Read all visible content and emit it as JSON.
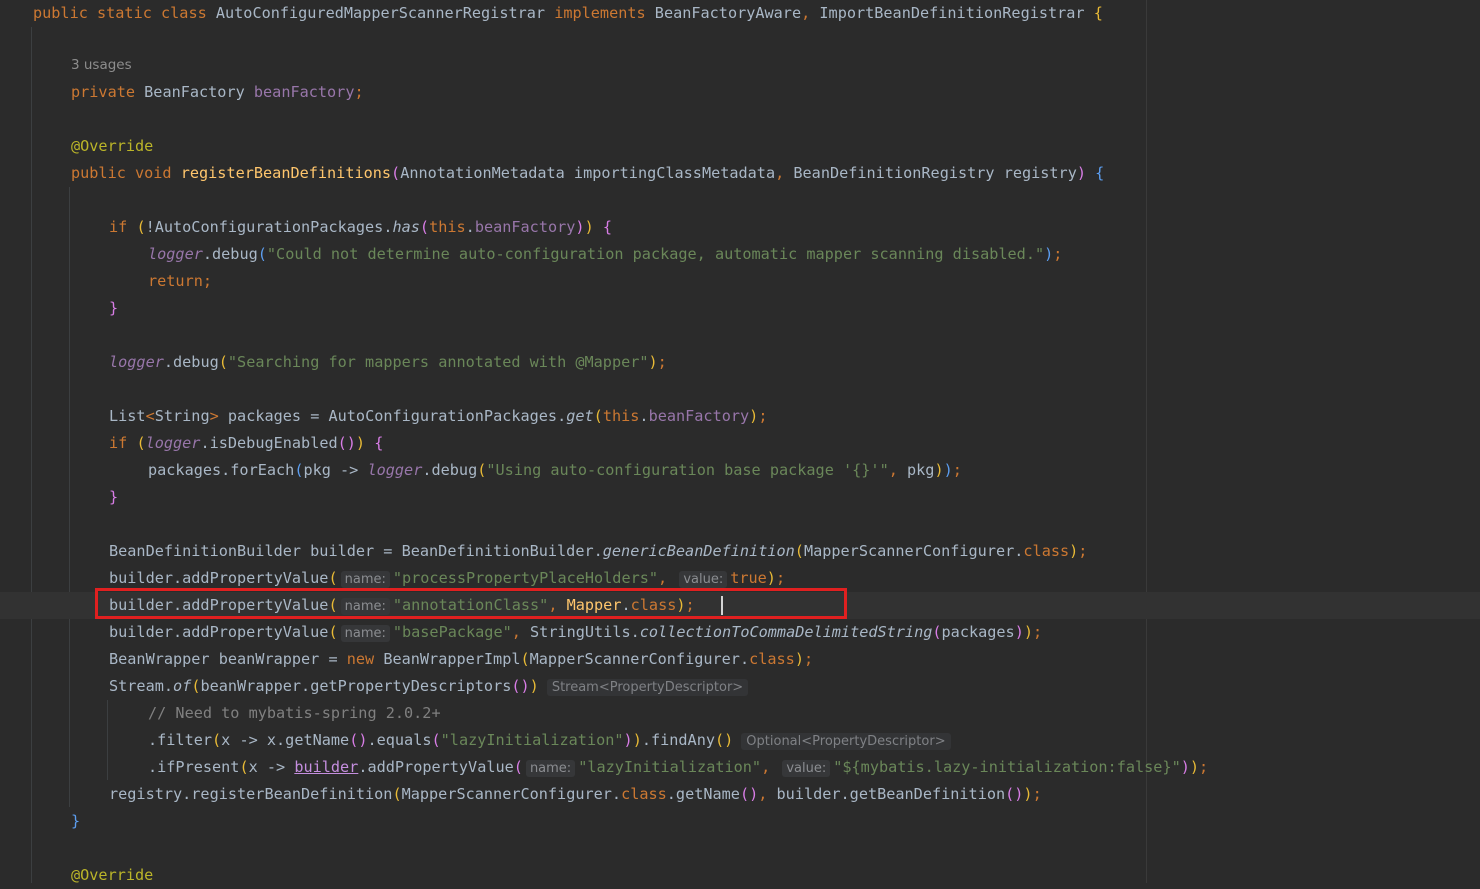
{
  "editor": {
    "usages_hint": "3 usages",
    "lines": [
      {
        "tokens": [
          {
            "t": "public static class ",
            "c": "kw"
          },
          {
            "t": "AutoConfiguredMapperScannerRegistrar "
          },
          {
            "t": "implements ",
            "c": "kw"
          },
          {
            "t": "BeanFactoryAware"
          },
          {
            "t": ", ",
            "c": "kw"
          },
          {
            "t": "ImportBeanDefinitionRegistrar "
          },
          {
            "t": "{",
            "c": "b1"
          }
        ]
      },
      {
        "tokens": [
          {
            "t": "private ",
            "c": "kw"
          },
          {
            "t": "BeanFactory "
          },
          {
            "t": "beanFactory",
            "c": "fld"
          },
          {
            "t": ";",
            "c": "kw"
          }
        ]
      },
      {
        "tokens": [
          {
            "t": "@Override",
            "c": "ann"
          }
        ]
      },
      {
        "tokens": [
          {
            "t": "public void ",
            "c": "kw"
          },
          {
            "t": "registerBeanDefinitions",
            "c": "fn"
          },
          {
            "t": "(",
            "c": "b2"
          },
          {
            "t": "AnnotationMetadata importingClassMetadata"
          },
          {
            "t": ", ",
            "c": "kw"
          },
          {
            "t": "BeanDefinitionRegistry registry"
          },
          {
            "t": ") ",
            "c": "b2"
          },
          {
            "t": "{",
            "c": "b3"
          }
        ]
      },
      {
        "tokens": [
          {
            "t": "if ",
            "c": "kw"
          },
          {
            "t": "(",
            "c": "b1"
          },
          {
            "t": "!AutoConfigurationPackages."
          },
          {
            "t": "has",
            "c": "it"
          },
          {
            "t": "(",
            "c": "b2"
          },
          {
            "t": "this",
            "c": "kw"
          },
          {
            "t": "."
          },
          {
            "t": "beanFactory",
            "c": "fld"
          },
          {
            "t": ")",
            "c": "b2"
          },
          {
            "t": ") ",
            "c": "b1"
          },
          {
            "t": "{",
            "c": "b2"
          }
        ]
      },
      {
        "tokens": [
          {
            "t": "logger",
            "c": "sfld"
          },
          {
            "t": ".debug"
          },
          {
            "t": "(",
            "c": "b3"
          },
          {
            "t": "\"Could not determine auto-configuration package, automatic mapper scanning disabled.\"",
            "c": "str"
          },
          {
            "t": ")",
            "c": "b3"
          },
          {
            "t": ";",
            "c": "kw"
          }
        ]
      },
      {
        "tokens": [
          {
            "t": "return;",
            "c": "kw"
          }
        ]
      },
      {
        "tokens": [
          {
            "t": "}",
            "c": "b2"
          }
        ]
      },
      {
        "tokens": [
          {
            "t": "logger",
            "c": "sfld"
          },
          {
            "t": ".debug"
          },
          {
            "t": "(",
            "c": "b1"
          },
          {
            "t": "\"Searching for mappers annotated with @Mapper\"",
            "c": "str"
          },
          {
            "t": ")",
            "c": "b1"
          },
          {
            "t": ";",
            "c": "kw"
          }
        ]
      },
      {
        "tokens": [
          {
            "t": "List"
          },
          {
            "t": "<",
            "c": "kw"
          },
          {
            "t": "String"
          },
          {
            "t": ">",
            "c": "kw"
          },
          {
            "t": " packages = AutoConfigurationPackages."
          },
          {
            "t": "get",
            "c": "it"
          },
          {
            "t": "(",
            "c": "b1"
          },
          {
            "t": "this",
            "c": "kw"
          },
          {
            "t": "."
          },
          {
            "t": "beanFactory",
            "c": "fld"
          },
          {
            "t": ")",
            "c": "b1"
          },
          {
            "t": ";",
            "c": "kw"
          }
        ]
      },
      {
        "tokens": [
          {
            "t": "if ",
            "c": "kw"
          },
          {
            "t": "(",
            "c": "b1"
          },
          {
            "t": "logger",
            "c": "sfld"
          },
          {
            "t": ".isDebugEnabled"
          },
          {
            "t": "()",
            "c": "b2"
          },
          {
            "t": ") ",
            "c": "b1"
          },
          {
            "t": "{",
            "c": "b2"
          }
        ]
      },
      {
        "tokens": [
          {
            "t": "packages.forEach"
          },
          {
            "t": "(",
            "c": "b3"
          },
          {
            "t": "pkg -> "
          },
          {
            "t": "logger",
            "c": "sfld"
          },
          {
            "t": ".debug"
          },
          {
            "t": "(",
            "c": "b1"
          },
          {
            "t": "\"Using auto-configuration base package '{}'\"",
            "c": "str"
          },
          {
            "t": ", ",
            "c": "kw"
          },
          {
            "t": "pkg"
          },
          {
            "t": ")",
            "c": "b1"
          },
          {
            "t": ")",
            "c": "b3"
          },
          {
            "t": ";",
            "c": "kw"
          }
        ]
      },
      {
        "tokens": [
          {
            "t": "}",
            "c": "b2"
          }
        ]
      },
      {
        "tokens": [
          {
            "t": "BeanDefinitionBuilder builder = BeanDefinitionBuilder."
          },
          {
            "t": "genericBeanDefinition",
            "c": "it"
          },
          {
            "t": "(",
            "c": "b1"
          },
          {
            "t": "MapperScannerConfigurer."
          },
          {
            "t": "class",
            "c": "kw"
          },
          {
            "t": ")",
            "c": "b1"
          },
          {
            "t": ";",
            "c": "kw"
          }
        ]
      },
      {
        "tokens": [
          {
            "t": "builder.addPropertyValue"
          },
          {
            "t": "(",
            "c": "b1"
          },
          {
            "hint": "name:"
          },
          {
            "t": "\"processPropertyPlaceHolders\"",
            "c": "str"
          },
          {
            "t": ", ",
            "c": "kw"
          },
          {
            "hint": "value:"
          },
          {
            "t": "true",
            "c": "kw"
          },
          {
            "t": ")",
            "c": "b1"
          },
          {
            "t": ";",
            "c": "kw"
          }
        ]
      },
      {
        "tokens": [
          {
            "t": "builder.addPropertyValue"
          },
          {
            "t": "(",
            "c": "b1"
          },
          {
            "hint": "name:"
          },
          {
            "t": "\"annotationClass\"",
            "c": "str"
          },
          {
            "t": ", ",
            "c": "kw"
          },
          {
            "t": "Mapper",
            "c": "fn"
          },
          {
            "t": "."
          },
          {
            "t": "class",
            "c": "kw"
          },
          {
            "t": ")",
            "c": "b1"
          },
          {
            "t": ";",
            "c": "kw"
          }
        ]
      },
      {
        "tokens": [
          {
            "t": "builder.addPropertyValue"
          },
          {
            "t": "(",
            "c": "b1"
          },
          {
            "hint": "name:"
          },
          {
            "t": "\"basePackage\"",
            "c": "str"
          },
          {
            "t": ", ",
            "c": "kw"
          },
          {
            "t": "StringUtils."
          },
          {
            "t": "collectionToCommaDelimitedString",
            "c": "it"
          },
          {
            "t": "(",
            "c": "b2"
          },
          {
            "t": "packages"
          },
          {
            "t": ")",
            "c": "b2"
          },
          {
            "t": ")",
            "c": "b1"
          },
          {
            "t": ";",
            "c": "kw"
          }
        ]
      },
      {
        "tokens": [
          {
            "t": "BeanWrapper beanWrapper = "
          },
          {
            "t": "new ",
            "c": "kw"
          },
          {
            "t": "BeanWrapperImpl"
          },
          {
            "t": "(",
            "c": "b1"
          },
          {
            "t": "MapperScannerConfigurer."
          },
          {
            "t": "class",
            "c": "kw"
          },
          {
            "t": ")",
            "c": "b1"
          },
          {
            "t": ";",
            "c": "kw"
          }
        ]
      },
      {
        "tokens": [
          {
            "t": "Stream."
          },
          {
            "t": "of",
            "c": "it"
          },
          {
            "t": "(",
            "c": "b1"
          },
          {
            "t": "beanWrapper.getPropertyDescriptors"
          },
          {
            "t": "()",
            "c": "b2"
          },
          {
            "t": ")",
            "c": "b1"
          },
          {
            "typehint": "Stream<PropertyDescriptor>"
          }
        ]
      },
      {
        "tokens": [
          {
            "t": "// Need to mybatis-spring 2.0.2+",
            "c": "cm"
          }
        ]
      },
      {
        "tokens": [
          {
            "t": ".filter"
          },
          {
            "t": "(",
            "c": "b1"
          },
          {
            "t": "x -> x.getName"
          },
          {
            "t": "()",
            "c": "b2"
          },
          {
            "t": ".equals"
          },
          {
            "t": "(",
            "c": "b2"
          },
          {
            "t": "\"lazyInitialization\"",
            "c": "str"
          },
          {
            "t": ")",
            "c": "b2"
          },
          {
            "t": ")",
            "c": "b1"
          },
          {
            "t": ".findAny"
          },
          {
            "t": "()",
            "c": "b1"
          },
          {
            "typehint": "Optional<PropertyDescriptor>"
          }
        ]
      },
      {
        "tokens": [
          {
            "t": ".ifPresent"
          },
          {
            "t": "(",
            "c": "b1"
          },
          {
            "t": "x -> "
          },
          {
            "t": "builder",
            "c": "und"
          },
          {
            "t": ".addPropertyValue"
          },
          {
            "t": "(",
            "c": "b2"
          },
          {
            "hint": "name:"
          },
          {
            "t": "\"lazyInitialization\"",
            "c": "str"
          },
          {
            "t": ", ",
            "c": "kw"
          },
          {
            "hint": "value:"
          },
          {
            "t": "\"${mybatis.lazy-initialization:false}\"",
            "c": "str"
          },
          {
            "t": ")",
            "c": "b2"
          },
          {
            "t": ")",
            "c": "b1"
          },
          {
            "t": ";",
            "c": "kw"
          }
        ]
      },
      {
        "tokens": [
          {
            "t": "registry.registerBeanDefinition"
          },
          {
            "t": "(",
            "c": "b1"
          },
          {
            "t": "MapperScannerConfigurer."
          },
          {
            "t": "class",
            "c": "kw"
          },
          {
            "t": ".getName"
          },
          {
            "t": "()",
            "c": "b2"
          },
          {
            "t": ", ",
            "c": "kw"
          },
          {
            "t": "builder.getBeanDefinition"
          },
          {
            "t": "()",
            "c": "b2"
          },
          {
            "t": ")",
            "c": "b1"
          },
          {
            "t": ";",
            "c": "kw"
          }
        ]
      },
      {
        "tokens": [
          {
            "t": "}",
            "c": "b3"
          }
        ]
      },
      {
        "tokens": [
          {
            "t": "@Override",
            "c": "ann"
          }
        ]
      }
    ]
  },
  "colors": {
    "background": "#2b2b2b",
    "keyword": "#cc7832",
    "string": "#6a8759",
    "field": "#9876aa",
    "annotation": "#bbb529",
    "method": "#ffc66d",
    "highlight_box": "#e02020"
  }
}
